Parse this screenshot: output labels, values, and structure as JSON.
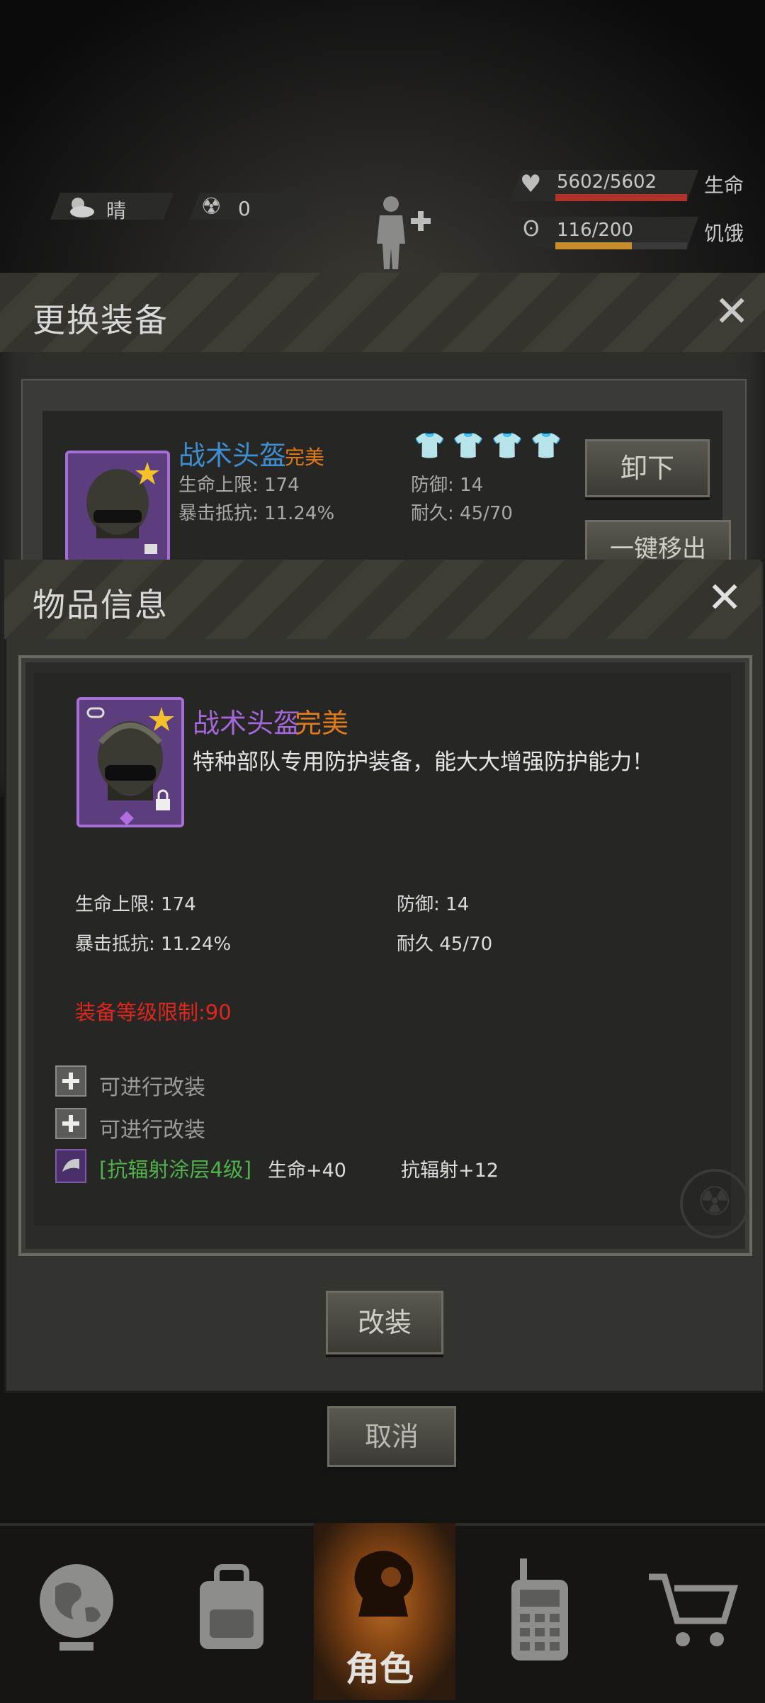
{
  "hud": {
    "weather": "晴",
    "radiation": "0",
    "hp_value": "5602/5602",
    "hp_label": "生命",
    "hp_fill": 1.0,
    "hunger_value": "116/200",
    "hunger_label": "饥饿",
    "hunger_fill": 0.58
  },
  "back_dialog": {
    "title": "更换装备",
    "item_name": "战术头盔",
    "item_quality": "完美",
    "stat_hp": "生命上限: 174",
    "stat_crit": "暴击抵抗: 11.24%",
    "stat_def": "防御: 14",
    "stat_dur": "耐久: 45/70",
    "unequip_label": "卸下",
    "remove_all_label": "一键移出"
  },
  "dialog": {
    "title": "物品信息",
    "item_name": "战术头盔",
    "item_quality": "完美",
    "description": "特种部队专用防护装备，能大大增强防护能力！",
    "stat_hp": "生命上限: 174",
    "stat_def": "防御: 14",
    "stat_crit": "暴击抵抗: 11.24%",
    "stat_dur": "耐久 45/70",
    "level_req": "装备等级限制:90",
    "mod_slots": [
      {
        "label": "可进行改装"
      },
      {
        "label": "可进行改装"
      }
    ],
    "mod_installed": {
      "name": "[抗辐射涂层4级]",
      "bonus1": "生命+40",
      "bonus2": "抗辐射+12"
    },
    "modify_label": "改装"
  },
  "cancel_label": "取消",
  "nav": {
    "selected_label": "角色"
  },
  "colors": {
    "purple": "#a467d8",
    "orange": "#e07a1a",
    "blue": "#3f8fd0",
    "red": "#e0261d",
    "green": "#4fb34a",
    "hp_bar": "#b0322b",
    "hunger_bar": "#c88d2a"
  }
}
